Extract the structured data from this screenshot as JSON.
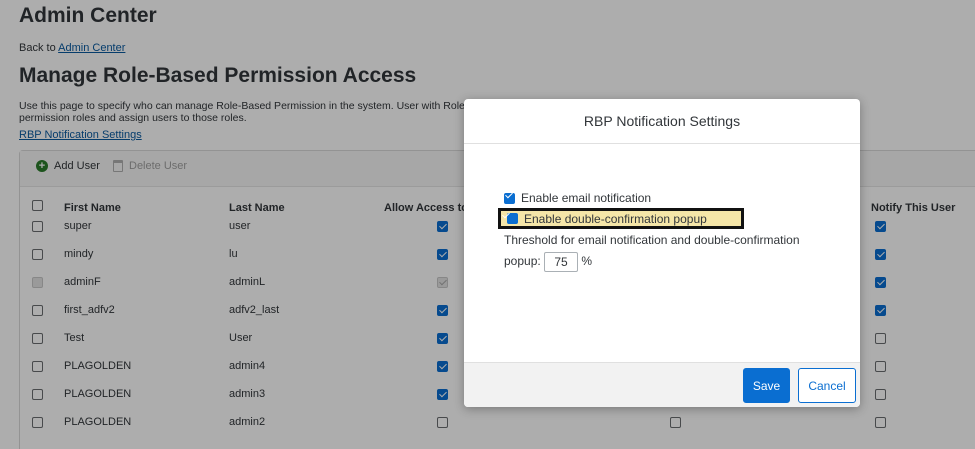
{
  "header": {
    "admin_title": "Admin Center",
    "back_prefix": "Back to ",
    "back_link": "Admin Center",
    "page_title": "Manage Role-Based Permission Access",
    "description": "Use this page to specify who can manage Role-Based Permission in the system. User with Role-",
    "description_line2": "permission roles and assign users to those roles.",
    "rbp_link": "RBP Notification Settings"
  },
  "toolbar": {
    "add_label": "Add User",
    "delete_label": "Delete User"
  },
  "table": {
    "columns": {
      "first_name": "First Name",
      "last_name": "Last Name",
      "allow_access": "Allow Access to",
      "notify": "Notify This User"
    },
    "rows": [
      {
        "first": "super",
        "last": "user",
        "allow": true,
        "allow_disabled": false,
        "mid": null,
        "notify": true
      },
      {
        "first": "mindy",
        "last": "lu",
        "allow": true,
        "allow_disabled": false,
        "mid": null,
        "notify": true
      },
      {
        "first": "adminF",
        "last": "adminL",
        "allow": true,
        "allow_disabled": true,
        "mid": null,
        "notify": true
      },
      {
        "first": "first_adfv2",
        "last": "adfv2_last",
        "allow": true,
        "allow_disabled": false,
        "mid": null,
        "notify": true
      },
      {
        "first": "Test",
        "last": "User",
        "allow": true,
        "allow_disabled": false,
        "mid": null,
        "notify": false
      },
      {
        "first": "PLAGOLDEN",
        "last": "admin4",
        "allow": true,
        "allow_disabled": false,
        "mid": null,
        "notify": false
      },
      {
        "first": "PLAGOLDEN",
        "last": "admin3",
        "allow": true,
        "allow_disabled": false,
        "mid": null,
        "notify": false
      },
      {
        "first": "PLAGOLDEN",
        "last": "admin2",
        "allow": false,
        "allow_disabled": false,
        "mid": false,
        "notify": false
      }
    ]
  },
  "dialog": {
    "title": "RBP Notification Settings",
    "email_label": "Enable email notification",
    "email_checked": true,
    "double_label": "Enable double-confirmation popup",
    "double_checked": true,
    "threshold_text": "Threshold for email notification and double-confirmation",
    "threshold_prefix": "popup:",
    "threshold_value": "75",
    "threshold_unit": "%",
    "save_label": "Save",
    "cancel_label": "Cancel"
  },
  "colors": {
    "accent": "#0a6ed1",
    "highlight": "#f5e6a8",
    "link": "#0a5aa0"
  }
}
